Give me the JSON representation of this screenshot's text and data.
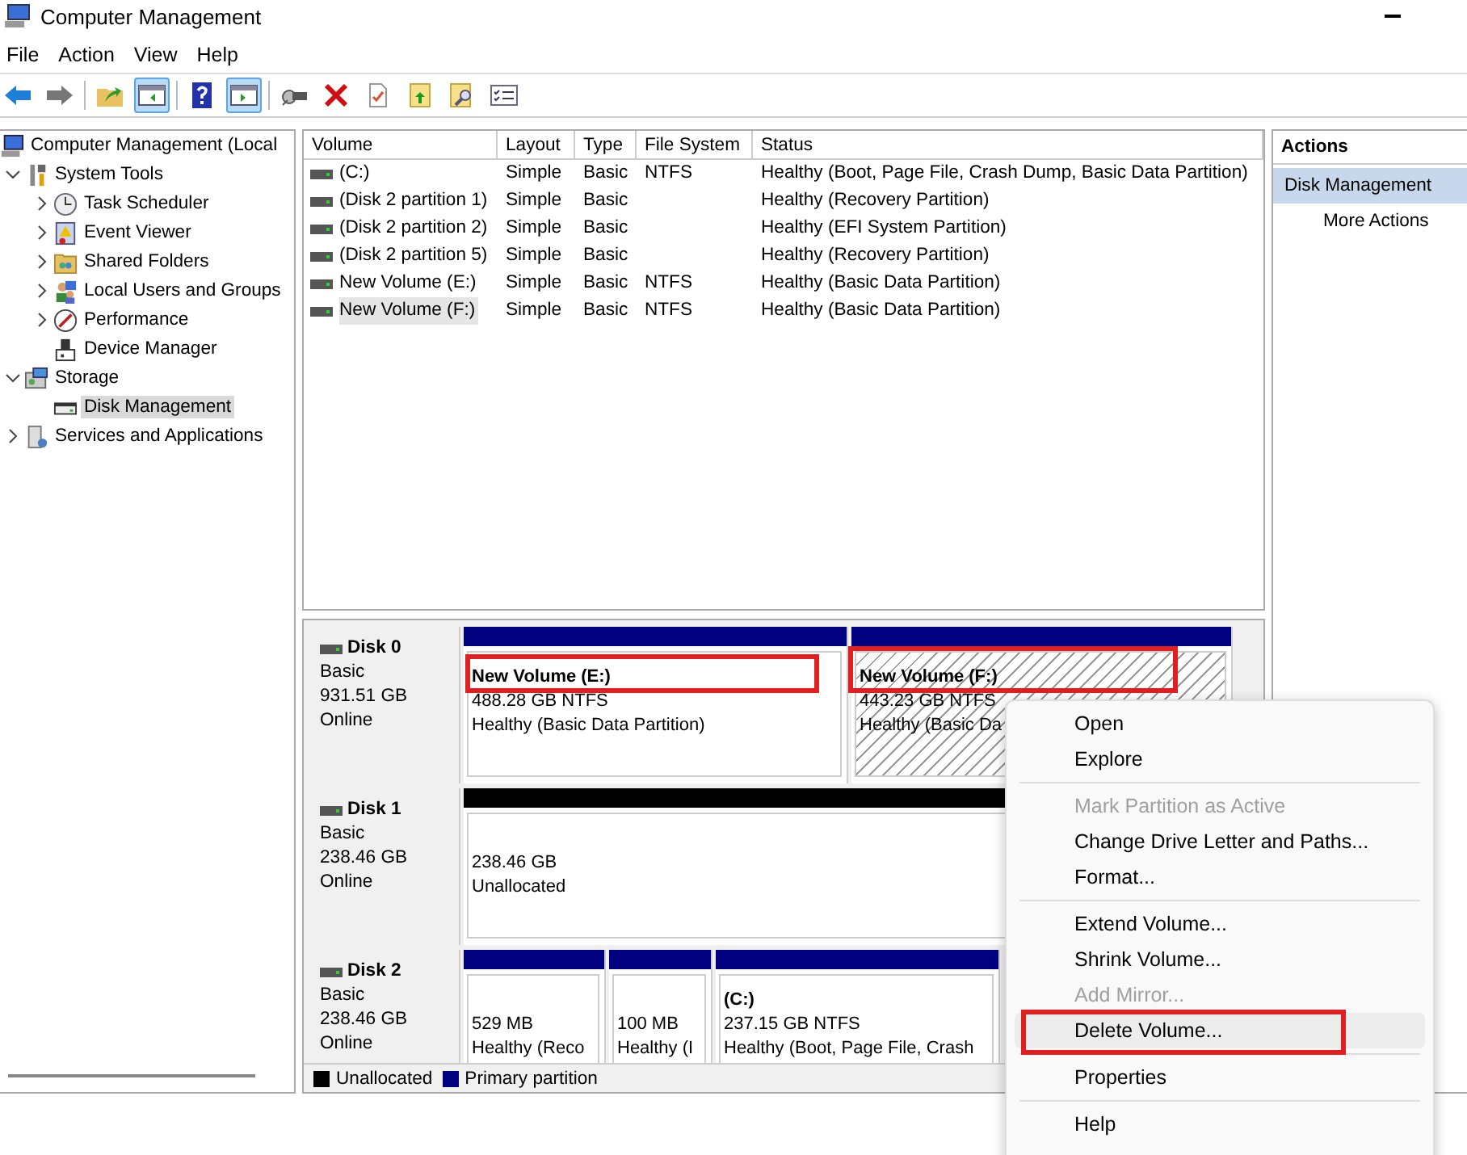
{
  "window": {
    "title": "Computer Management"
  },
  "menu": [
    "File",
    "Action",
    "View",
    "Help"
  ],
  "toolbar": [
    [
      {
        "kind": "back",
        "on": false
      },
      {
        "kind": "forward",
        "on": false
      }
    ],
    [
      {
        "kind": "up",
        "on": false
      },
      {
        "kind": "pane",
        "on": true
      }
    ],
    [
      {
        "kind": "help",
        "on": false
      },
      {
        "kind": "pane2",
        "on": true
      }
    ],
    [
      {
        "kind": "connect",
        "on": false
      },
      {
        "kind": "delete",
        "on": false
      },
      {
        "kind": "check",
        "on": false
      },
      {
        "kind": "folderup",
        "on": false
      },
      {
        "kind": "search",
        "on": false
      },
      {
        "kind": "list",
        "on": false
      }
    ]
  ],
  "tree": [
    {
      "label": "Computer Management (Local",
      "kind": "computer",
      "selected": false,
      "children": [
        {
          "label": "System Tools",
          "kind": "tools",
          "expanded": true,
          "selected": false,
          "children": [
            {
              "label": "Task Scheduler",
              "kind": "clock",
              "expanded": false,
              "selected": false
            },
            {
              "label": "Event Viewer",
              "kind": "event",
              "expanded": false,
              "selected": false
            },
            {
              "label": "Shared Folders",
              "kind": "folder",
              "expanded": false,
              "selected": false
            },
            {
              "label": "Local Users and Groups",
              "kind": "users",
              "expanded": false,
              "selected": false
            },
            {
              "label": "Performance",
              "kind": "perf",
              "expanded": false,
              "selected": false
            },
            {
              "label": "Device Manager",
              "kind": "device",
              "selected": false
            }
          ]
        },
        {
          "label": "Storage",
          "kind": "storage",
          "expanded": true,
          "selected": false,
          "children": [
            {
              "label": "Disk Management",
              "kind": "disk",
              "selected": true
            }
          ]
        },
        {
          "label": "Services and Applications",
          "kind": "services",
          "expanded": false,
          "selected": false
        }
      ]
    }
  ],
  "table": {
    "columns": [
      "Volume",
      "Layout",
      "Type",
      "File System",
      "Status"
    ],
    "rows": [
      {
        "cells": [
          " (C:)",
          "Simple",
          "Basic",
          "NTFS",
          "Healthy (Boot, Page File, Crash Dump, Basic Data Partition)"
        ],
        "selected": false
      },
      {
        "cells": [
          "(Disk 2 partition 1)",
          "Simple",
          "Basic",
          "",
          "Healthy (Recovery Partition)"
        ],
        "selected": false
      },
      {
        "cells": [
          "(Disk 2 partition 2)",
          "Simple",
          "Basic",
          "",
          "Healthy (EFI System Partition)"
        ],
        "selected": false
      },
      {
        "cells": [
          "(Disk 2 partition 5)",
          "Simple",
          "Basic",
          "",
          "Healthy (Recovery Partition)"
        ],
        "selected": false
      },
      {
        "cells": [
          "New Volume (E:)",
          "Simple",
          "Basic",
          "NTFS",
          "Healthy (Basic Data Partition)"
        ],
        "selected": false
      },
      {
        "cells": [
          "New Volume (F:)",
          "Simple",
          "Basic",
          "NTFS",
          "Healthy (Basic Data Partition)"
        ],
        "selected": true
      }
    ]
  },
  "disks": [
    {
      "name": "Disk 0",
      "type": "Basic",
      "size": "931.51 GB",
      "state": "Online",
      "partitions": [
        {
          "title": "New Volume  (E:)",
          "size": "488.28 GB NTFS",
          "status": "Healthy (Basic Data Partition)",
          "color": "#000080",
          "selected": false,
          "outlined": true
        },
        {
          "title": "New Volume  (F:)",
          "size": "443.23 GB NTFS",
          "status": "Healthy (Basic Da",
          "color": "#000080",
          "selected": true,
          "outlined": true
        }
      ]
    },
    {
      "name": "Disk 1",
      "type": "Basic",
      "size": "238.46 GB",
      "state": "Online",
      "partitions": [
        {
          "size": "238.46 GB",
          "status": "Unallocated",
          "color": "#000000",
          "selected": false,
          "outlined": false
        }
      ]
    },
    {
      "name": "Disk 2",
      "type": "Basic",
      "size": "238.46 GB",
      "state": "Online",
      "partitions": [
        {
          "size": "529 MB",
          "status": "Healthy (Reco",
          "color": "#000080",
          "selected": false,
          "outlined": false
        },
        {
          "size": "100 MB",
          "status": "Healthy (I",
          "color": "#000080",
          "selected": false,
          "outlined": false
        },
        {
          "title": "(C:)",
          "size": "237.15 GB NTFS",
          "status": "Healthy (Boot, Page File, Crash",
          "color": "#000080",
          "selected": false,
          "outlined": false
        }
      ]
    }
  ],
  "legend": [
    {
      "label": "Unallocated",
      "color": "#000000"
    },
    {
      "label": "Primary partition",
      "color": "#000080"
    }
  ],
  "actions": {
    "title": "Actions",
    "section": "Disk Management",
    "items": [
      "More Actions"
    ]
  },
  "context_menu": [
    {
      "label": "Open",
      "kind": "item",
      "disabled": false,
      "selected": false,
      "outlined": false
    },
    {
      "label": "Explore",
      "kind": "item",
      "disabled": false,
      "selected": false,
      "outlined": false
    },
    {
      "kind": "separator"
    },
    {
      "label": "Mark Partition as Active",
      "kind": "item",
      "disabled": true,
      "selected": false,
      "outlined": false
    },
    {
      "label": "Change Drive Letter and Paths...",
      "kind": "item",
      "disabled": false,
      "selected": false,
      "outlined": false
    },
    {
      "label": "Format...",
      "kind": "item",
      "disabled": false,
      "selected": false,
      "outlined": false
    },
    {
      "kind": "separator"
    },
    {
      "label": "Extend Volume...",
      "kind": "item",
      "disabled": false,
      "selected": false,
      "outlined": false
    },
    {
      "label": "Shrink Volume...",
      "kind": "item",
      "disabled": false,
      "selected": false,
      "outlined": false
    },
    {
      "label": "Add Mirror...",
      "kind": "item",
      "disabled": true,
      "selected": false,
      "outlined": false
    },
    {
      "label": "Delete Volume...",
      "kind": "item",
      "disabled": false,
      "selected": true,
      "outlined": true
    },
    {
      "kind": "separator"
    },
    {
      "label": "Properties",
      "kind": "item",
      "disabled": false,
      "selected": false,
      "outlined": false
    },
    {
      "kind": "separator"
    },
    {
      "label": "Help",
      "kind": "item",
      "disabled": false,
      "selected": false,
      "outlined": false
    }
  ]
}
